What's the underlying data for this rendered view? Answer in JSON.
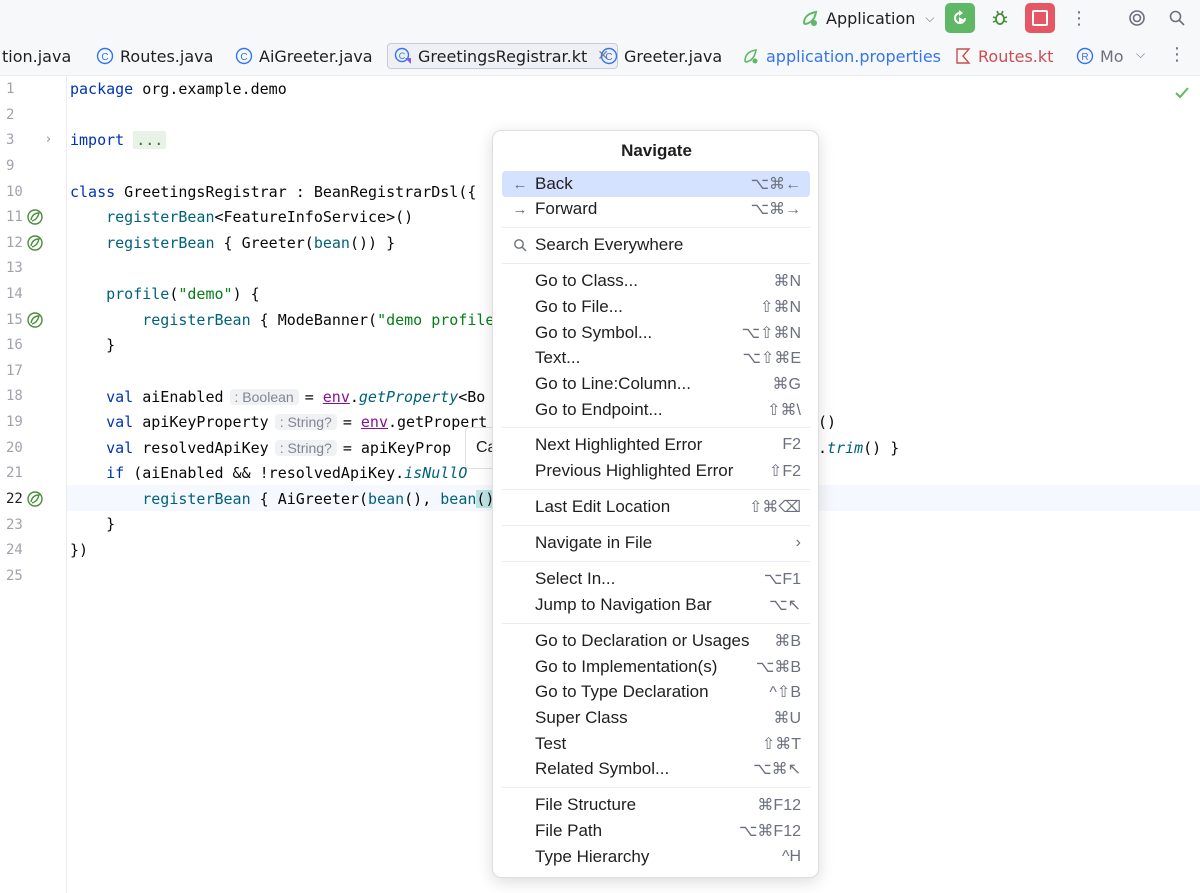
{
  "toolbar": {
    "run_config": "Application",
    "colors": {
      "rerun": "#5fb865",
      "stop": "#e55765"
    }
  },
  "tabs": [
    {
      "label": "tion.java",
      "icon": "java-file-icon"
    },
    {
      "label": "Routes.java",
      "icon": "class-icon"
    },
    {
      "label": "AiGreeter.java",
      "icon": "class-icon"
    },
    {
      "label": "GreetingsRegistrar.kt",
      "icon": "kotlin-class-icon",
      "active": true
    },
    {
      "label": "Greeter.java",
      "icon": "class-icon"
    },
    {
      "label": "application.properties",
      "icon": "spring-properties-icon"
    },
    {
      "label": "Routes.kt",
      "icon": "kotlin-file-icon"
    },
    {
      "label": "Mo",
      "icon": "record-icon"
    }
  ],
  "gutter": {
    "line_numbers": [
      "1",
      "2",
      "3",
      "9",
      "10",
      "11",
      "12",
      "13",
      "14",
      "15",
      "16",
      "17",
      "18",
      "19",
      "20",
      "21",
      "22",
      "23",
      "24",
      "25"
    ]
  },
  "code": {
    "l1_kw": "package",
    "l1_rest": " org.example.demo",
    "l3_kw": "import",
    "l3_fold": "...",
    "l10_kw": "class",
    "l10_rest": " GreetingsRegistrar : BeanRegistrarDsl({",
    "l11_fn": "registerBean",
    "l11_rest": "<FeatureInfoService>()",
    "l12_fn": "registerBean",
    "l12_a": " { Greeter(",
    "l12_b": "bean",
    "l12_c": "()) }",
    "l14_fn": "profile",
    "l14_a": "(",
    "l14_str": "\"demo\"",
    "l14_b": ") {",
    "l15_fn": "registerBean",
    "l15_a": " { ModeBanner(",
    "l15_str": "\"demo profile",
    "l16": "}",
    "l18_kw": "val",
    "l18_name": " aiEnabled",
    "l18_hint": ": Boolean",
    "l18_a": "= ",
    "l18_env": "env",
    "l18_b": ".",
    "l18_call": "getProperty",
    "l18_c": "<Bo",
    "l19_kw": "val",
    "l19_name": " apiKeyProperty",
    "l19_hint": ": String?",
    "l19_a": "= ",
    "l19_env": "env",
    "l19_b": ".getPropert",
    "l19_tail": "()",
    "l20_kw": "val",
    "l20_name": " resolvedApiKey",
    "l20_hint": ": String?",
    "l20_a": "= apiKeyProp",
    "l20_tail_a": ".",
    "l20_tail_call": "trim",
    "l20_tail_b": "() }",
    "l21_kw": "if",
    "l21_a": " (aiEnabled && !resolvedApiKey.",
    "l21_call": "isNullO",
    "l22_fn": "registerBean",
    "l22_a": " { AiGreeter(",
    "l22_b": "bean",
    "l22_c": "(), ",
    "l22_d": "bean",
    "l22_e": "()",
    "l23": "}",
    "l24": "})"
  },
  "tooltip_peek": "Ca",
  "popup": {
    "title": "Navigate",
    "groups": [
      [
        {
          "icon": "arrow-left-icon",
          "label": "Back",
          "shortcut": "⌥⌘←",
          "selected": true
        },
        {
          "icon": "arrow-right-icon",
          "label": "Forward",
          "shortcut": "⌥⌘→"
        }
      ],
      [
        {
          "icon": "search-icon",
          "label": "Search Everywhere",
          "shortcut": ""
        }
      ],
      [
        {
          "label": "Go to Class...",
          "shortcut": "⌘N"
        },
        {
          "label": "Go to File...",
          "shortcut": "⇧⌘N"
        },
        {
          "label": "Go to Symbol...",
          "shortcut": "⌥⇧⌘N"
        },
        {
          "label": "Text...",
          "shortcut": "⌥⇧⌘E"
        },
        {
          "label": "Go to Line:Column...",
          "shortcut": "⌘G"
        },
        {
          "label": "Go to Endpoint...",
          "shortcut": "⇧⌘\\"
        }
      ],
      [
        {
          "label": "Next Highlighted Error",
          "shortcut": "F2"
        },
        {
          "label": "Previous Highlighted Error",
          "shortcut": "⇧F2"
        }
      ],
      [
        {
          "label": "Last Edit Location",
          "shortcut": "⇧⌘⌫"
        }
      ],
      [
        {
          "label": "Navigate in File",
          "shortcut": "›"
        }
      ],
      [
        {
          "label": "Select In...",
          "shortcut": "⌥F1"
        },
        {
          "label": "Jump to Navigation Bar",
          "shortcut": "⌥↖"
        }
      ],
      [
        {
          "label": "Go to Declaration or Usages",
          "shortcut": "⌘B"
        },
        {
          "label": "Go to Implementation(s)",
          "shortcut": "⌥⌘B"
        },
        {
          "label": "Go to Type Declaration",
          "shortcut": "^⇧B"
        },
        {
          "label": "Super Class",
          "shortcut": "⌘U"
        },
        {
          "label": "Test",
          "shortcut": "⇧⌘T"
        },
        {
          "label": "Related Symbol...",
          "shortcut": "⌥⌘↖"
        }
      ],
      [
        {
          "label": "File Structure",
          "shortcut": "⌘F12"
        },
        {
          "label": "File Path",
          "shortcut": "⌥⌘F12"
        },
        {
          "label": "Type Hierarchy",
          "shortcut": "^H"
        }
      ]
    ]
  }
}
